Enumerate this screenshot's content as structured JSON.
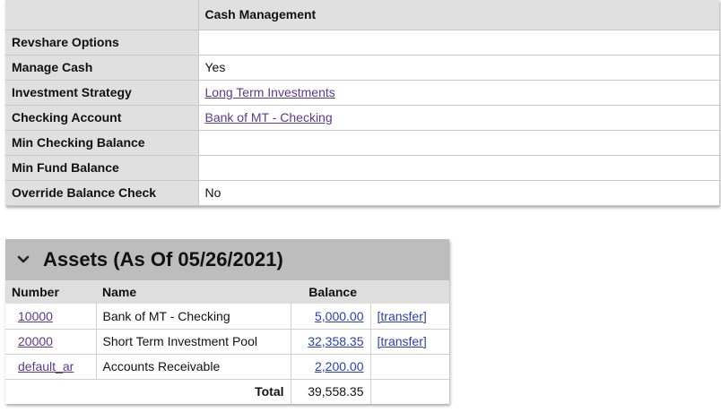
{
  "cash_management": {
    "header": "Cash Management",
    "rows": [
      {
        "label": "Revshare Options",
        "value": "",
        "link": false
      },
      {
        "label": "Manage Cash",
        "value": "Yes",
        "link": false
      },
      {
        "label": "Investment Strategy",
        "value": "Long Term Investments",
        "link": true
      },
      {
        "label": "Checking Account",
        "value": "Bank of MT - Checking",
        "link": true
      },
      {
        "label": "Min Checking Balance",
        "value": "",
        "link": false
      },
      {
        "label": "Min Fund Balance",
        "value": "",
        "link": false
      },
      {
        "label": "Override Balance Check",
        "value": "No",
        "link": false
      }
    ]
  },
  "assets": {
    "title": "Assets (As Of 05/26/2021)",
    "columns": {
      "number": "Number",
      "name": "Name",
      "balance": "Balance"
    },
    "rows": [
      {
        "number": "10000",
        "name": "Bank of MT - Checking",
        "balance": "5,000.00",
        "action": "[transfer]"
      },
      {
        "number": "20000",
        "name": "Short Term Investment Pool",
        "balance": "32,358.35",
        "action": "[transfer]"
      },
      {
        "number": "default_ar",
        "name": "Accounts Receivable",
        "balance": "2,200.00",
        "action": ""
      }
    ],
    "total_label": "Total",
    "total_value": "39,558.35"
  },
  "icons": {
    "collapse": "chevron-down-icon"
  }
}
